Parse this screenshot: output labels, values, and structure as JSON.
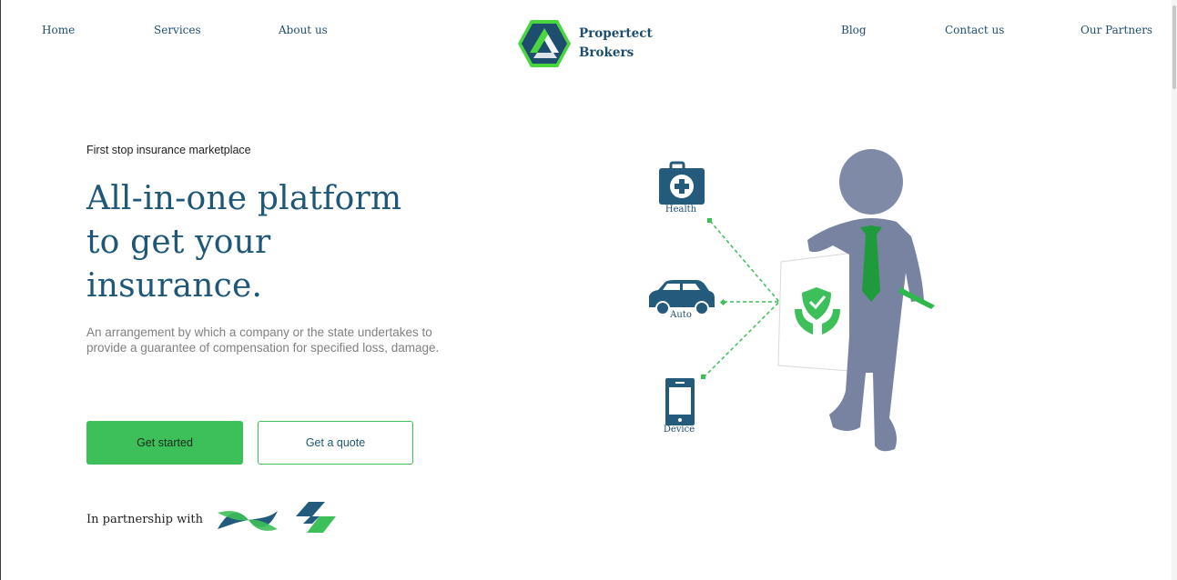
{
  "nav": {
    "left": [
      "Home",
      "Services",
      "About us"
    ],
    "right": [
      "Blog",
      "Contact us",
      "Our Partners"
    ]
  },
  "logo": {
    "line1": "Propertect",
    "line2": "Brokers"
  },
  "hero": {
    "eyebrow": "First stop insurance marketplace",
    "headline_line1": "All-in-one platform",
    "headline_line2": "to get your",
    "headline_line3": "insurance.",
    "description": "An arrangement by which a company or the state undertakes to provide a guarantee of compensation for specified loss, damage."
  },
  "buttons": {
    "primary": "Get started",
    "secondary": "Get a quote"
  },
  "partners": {
    "label": "In partnership with"
  },
  "illustration": {
    "categories": [
      "Health",
      "Auto",
      "Device"
    ]
  },
  "colors": {
    "brand_blue": "#1e5778",
    "brand_green": "#3dbf59",
    "icon_blue": "#245a7c"
  }
}
